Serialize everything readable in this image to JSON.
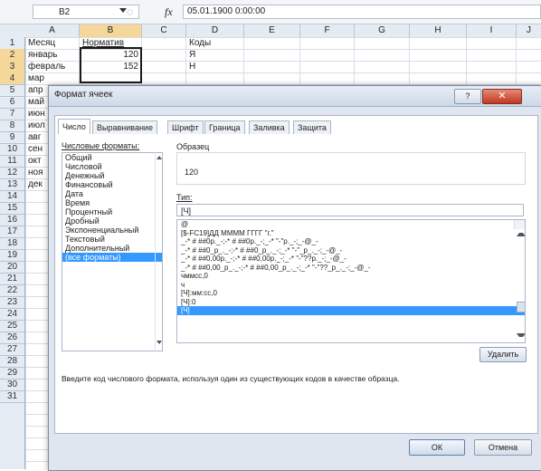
{
  "formula_bar": {
    "name_box": "B2",
    "fx_label": "fx",
    "formula": "05.01.1900 0:00:00"
  },
  "columns": [
    "A",
    "B",
    "C",
    "D",
    "E",
    "F",
    "G",
    "H",
    "I",
    "J"
  ],
  "rows": [
    "1",
    "2",
    "3",
    "4",
    "5",
    "6",
    "7",
    "8",
    "9",
    "10",
    "11",
    "12",
    "13",
    "14",
    "15",
    "16",
    "17",
    "18",
    "19",
    "20",
    "21",
    "22",
    "23",
    "24",
    "25",
    "26",
    "27",
    "28",
    "29",
    "30",
    "31"
  ],
  "cells": {
    "A1": "Месяц",
    "B1": "Норматив",
    "D1": "Коды",
    "A2": "январь",
    "B2": "120",
    "D2": "Я",
    "A3": "февраль",
    "B3": "152",
    "D3": "Н",
    "A4": "мар",
    "A5": "апр",
    "A6": "май",
    "A7": "июн",
    "A8": "июл",
    "A9": "авг",
    "A10": "сен",
    "A11": "окт",
    "A12": "ноя",
    "A13": "дек"
  },
  "dialog": {
    "title": "Формат ячеек",
    "help": "?",
    "close": "✕",
    "tabs": [
      "Число",
      "Выравнивание",
      "Шрифт",
      "Граница",
      "Заливка",
      "Защита"
    ],
    "categories_label": "Числовые форматы:",
    "categories": [
      "Общий",
      "Числовой",
      "Денежный",
      "Финансовый",
      "Дата",
      "Время",
      "Процентный",
      "Дробный",
      "Экспоненциальный",
      "Текстовый",
      "Дополнительный",
      "(все форматы)"
    ],
    "sample_label": "Образец",
    "sample_value": "120",
    "type_label": "Тип:",
    "type_value": "[Ч]",
    "formats": [
      "@",
      "[$-FC19]ДД ММММ ГГГГ \"г.\"",
      "_-* # ##0р._-;-* # ##0р._-;_-* \"-\"р._-;_-@_-",
      "_-* # ##0_р_._-;-* # ##0_р_._-;_-* \"-\"_р_._-;_-@_-",
      "_-* # ##0,00р._-;-* # ##0,00р._-;_-* \"-\"??р._-;_-@_-",
      "_-* # ##0,00_р_._-;-* # ##0,00_р_._-;_-* \"-\"??_р_._-;_-@_-",
      "чммсс,0",
      "ч",
      "[Ч]:мм:сс,0",
      "[Ч]:0",
      "[Ч]"
    ],
    "delete_button": "Удалить",
    "hint": "Введите код числового формата, используя один из существующих кодов в качестве образца.",
    "ok": "ОК",
    "cancel": "Отмена"
  },
  "colors": {
    "selection": "#3399ff",
    "close": "#c0391f"
  }
}
